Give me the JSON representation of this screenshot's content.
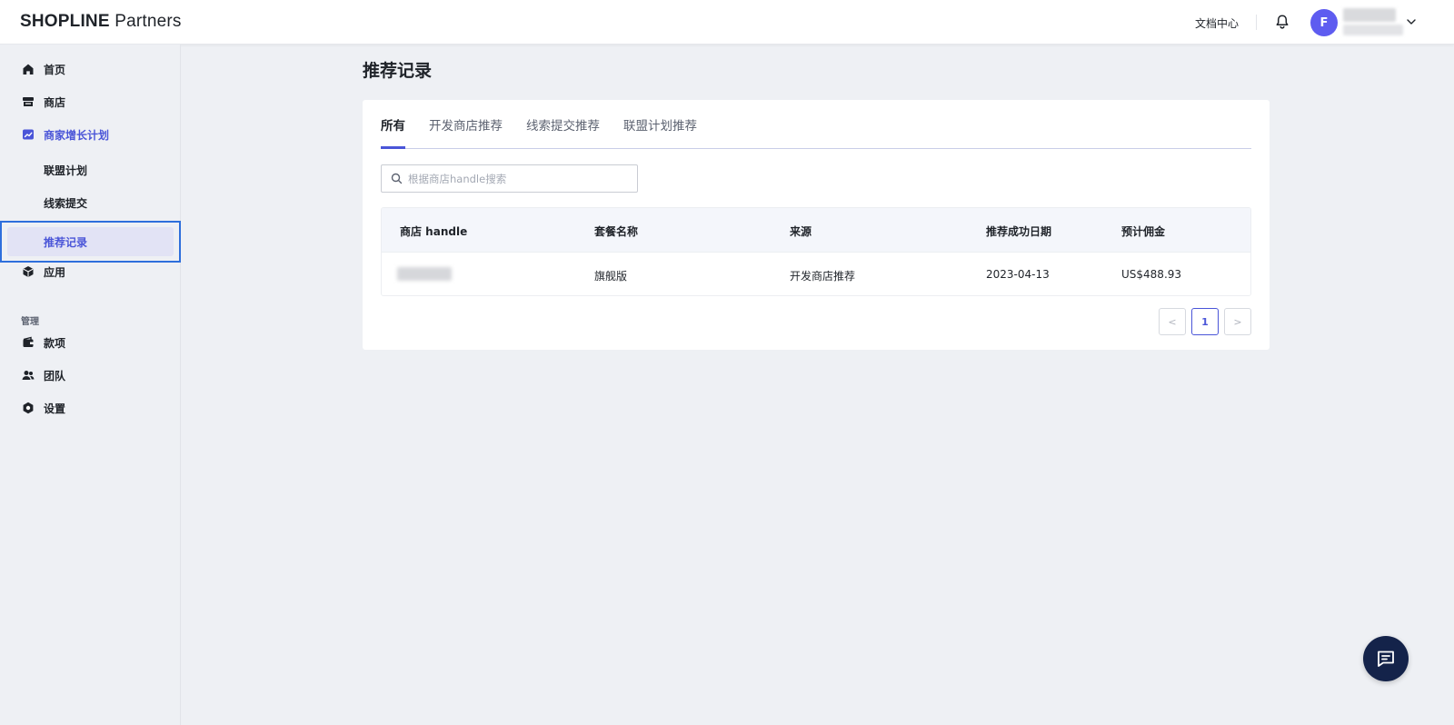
{
  "header": {
    "logo_brand": "SHOPLINE",
    "logo_suffix": "Partners",
    "docs_label": "文档中心",
    "avatar_initial": "F"
  },
  "sidebar": {
    "items": [
      {
        "label": "首页",
        "icon": "home-icon"
      },
      {
        "label": "商店",
        "icon": "store-icon"
      },
      {
        "label": "商家增长计划",
        "icon": "growth-chart-icon"
      },
      {
        "label": "联盟计划"
      },
      {
        "label": "线索提交"
      },
      {
        "label": "推荐记录"
      },
      {
        "label": "应用",
        "icon": "cube-icon"
      }
    ],
    "section_manage": "管理",
    "manage_items": [
      {
        "label": "款项",
        "icon": "wallet-icon"
      },
      {
        "label": "团队",
        "icon": "team-icon"
      },
      {
        "label": "设置",
        "icon": "settings-icon"
      }
    ]
  },
  "main": {
    "title": "推荐记录",
    "tabs": [
      {
        "label": "所有",
        "active": true
      },
      {
        "label": "开发商店推荐",
        "active": false
      },
      {
        "label": "线索提交推荐",
        "active": false
      },
      {
        "label": "联盟计划推荐",
        "active": false
      }
    ],
    "search": {
      "placeholder": "根据商店handle搜索",
      "value": ""
    },
    "table": {
      "columns": [
        "商店 handle",
        "套餐名称",
        "来源",
        "推荐成功日期",
        "预计佣金"
      ],
      "rows": [
        {
          "handle": "",
          "plan": "旗舰版",
          "source": "开发商店推荐",
          "date": "2023-04-13",
          "commission": "US$488.93"
        }
      ]
    },
    "pagination": {
      "prev": "<",
      "current": "1",
      "next": ">"
    }
  },
  "colors": {
    "accent": "#4a55d8",
    "avatar": "#5e5cf0",
    "chat_fab": "#14234a",
    "selection_outline": "#2e6fdc"
  }
}
